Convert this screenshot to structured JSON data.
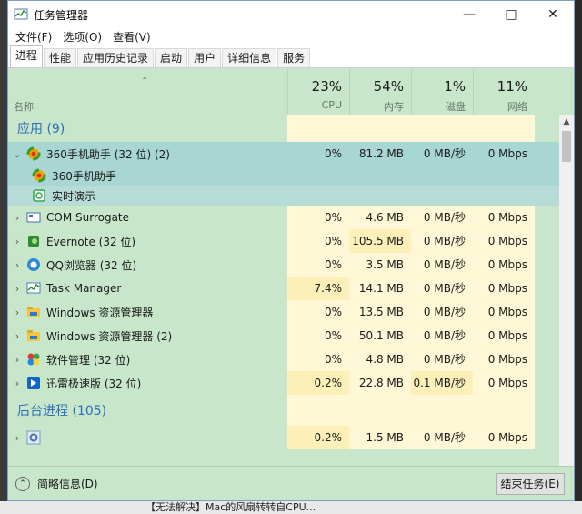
{
  "window": {
    "title": "任务管理器"
  },
  "menu": [
    "文件(F)",
    "选项(O)",
    "查看(V)"
  ],
  "tabs": [
    "进程",
    "性能",
    "应用历史记录",
    "启动",
    "用户",
    "详细信息",
    "服务"
  ],
  "header": {
    "name_label": "名称",
    "cpu": {
      "pct": "23%",
      "label": "CPU"
    },
    "mem": {
      "pct": "54%",
      "label": "内存"
    },
    "disk": {
      "pct": "1%",
      "label": "磁盘"
    },
    "net": {
      "pct": "11%",
      "label": "网络"
    }
  },
  "groups": {
    "apps": "应用 (9)",
    "background": "后台进程 (105)"
  },
  "rows": [
    {
      "name": "360手机助手 (32 位) (2)",
      "cpu": "0%",
      "mem": "81.2 MB",
      "disk": "0 MB/秒",
      "net": "0 Mbps",
      "icon": "360-icon"
    },
    {
      "name": "360手机助手"
    },
    {
      "name": "实时演示"
    },
    {
      "name": "COM Surrogate",
      "cpu": "0%",
      "mem": "4.6 MB",
      "disk": "0 MB/秒",
      "net": "0 Mbps",
      "icon": "com-icon"
    },
    {
      "name": "Evernote (32 位)",
      "cpu": "0%",
      "mem": "105.5 MB",
      "disk": "0 MB/秒",
      "net": "0 Mbps",
      "icon": "evernote-icon"
    },
    {
      "name": "QQ浏览器 (32 位)",
      "cpu": "0%",
      "mem": "3.5 MB",
      "disk": "0 MB/秒",
      "net": "0 Mbps",
      "icon": "qq-browser-icon"
    },
    {
      "name": "Task Manager",
      "cpu": "7.4%",
      "mem": "14.1 MB",
      "disk": "0 MB/秒",
      "net": "0 Mbps",
      "icon": "task-manager-icon"
    },
    {
      "name": "Windows 资源管理器",
      "cpu": "0%",
      "mem": "13.5 MB",
      "disk": "0 MB/秒",
      "net": "0 Mbps",
      "icon": "explorer-icon"
    },
    {
      "name": "Windows 资源管理器 (2)",
      "cpu": "0%",
      "mem": "50.1 MB",
      "disk": "0 MB/秒",
      "net": "0 Mbps",
      "icon": "explorer-icon"
    },
    {
      "name": "软件管理 (32 位)",
      "cpu": "0%",
      "mem": "4.8 MB",
      "disk": "0 MB/秒",
      "net": "0 Mbps",
      "icon": "software-icon"
    },
    {
      "name": "迅雷极速版 (32 位)",
      "cpu": "0.2%",
      "mem": "22.8 MB",
      "disk": "0.1 MB/秒",
      "net": "0 Mbps",
      "icon": "xunlei-icon"
    },
    {
      "name": "",
      "cpu": "0.2%",
      "mem": "1.5 MB",
      "disk": "0 MB/秒",
      "net": "0 Mbps",
      "icon": "gear-icon"
    }
  ],
  "footer": {
    "fewer": "简略信息(D)",
    "end_task": "结束任务(E)"
  },
  "bottom_bar": "【无法解决】Mac的风扇转转自CPU..."
}
